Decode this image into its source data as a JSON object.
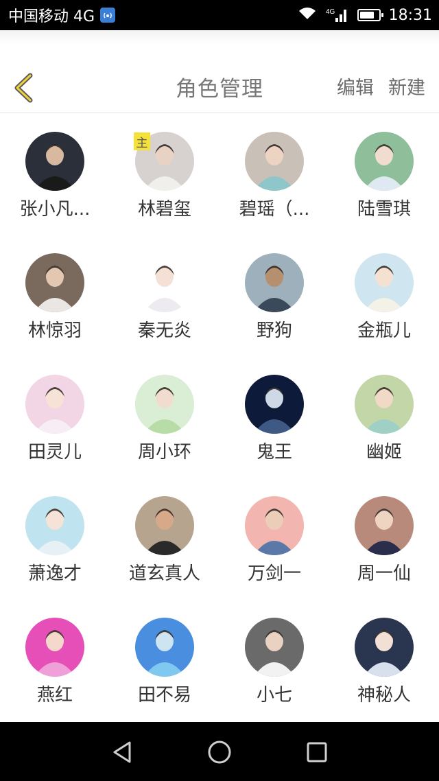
{
  "status_bar": {
    "carrier": "中国移动 4G",
    "signal_tag": "4G",
    "time": "18:31",
    "battery_level": 0.8
  },
  "header": {
    "title": "角色管理",
    "edit_label": "编辑",
    "new_label": "新建"
  },
  "owner_badge": "主",
  "characters": [
    {
      "name": "张小凡...",
      "bg": "#2a2f3a",
      "fg": "#1a1a1a",
      "skin": "#d8b8a0"
    },
    {
      "name": "林碧玺",
      "bg": "#d7d2cf",
      "fg": "#f1efec",
      "skin": "#e8d2c4"
    },
    {
      "name": "碧瑶（...",
      "bg": "#c9c0b8",
      "fg": "#8fc6c9",
      "skin": "#ecd3c2"
    },
    {
      "name": "陆雪琪",
      "bg": "#8fbf9a",
      "fg": "#dfe9f2",
      "skin": "#f0ddd0"
    },
    {
      "name": "林惊羽",
      "bg": "#7a6a5e",
      "fg": "#e9e6e3",
      "skin": "#e4c7b1"
    },
    {
      "name": "秦无炎",
      "bg": "#ffffff",
      "fg": "#eeeaf2",
      "skin": "#f4e0d4"
    },
    {
      "name": "野狗",
      "bg": "#9fb0bd",
      "fg": "#3a4a5a",
      "skin": "#b58f6e"
    },
    {
      "name": "金瓶儿",
      "bg": "#cfe6f0",
      "fg": "#f4f1e6",
      "skin": "#f5e1d2"
    },
    {
      "name": "田灵儿",
      "bg": "#f3d6e6",
      "fg": "#f7eef5",
      "skin": "#f6e2d6"
    },
    {
      "name": "周小环",
      "bg": "#d9eed5",
      "fg": "#b8dca8",
      "skin": "#f1ddd0"
    },
    {
      "name": "鬼王",
      "bg": "#0e1a3a",
      "fg": "#3e5a84",
      "skin": "#cdd9e6"
    },
    {
      "name": "幽姬",
      "bg": "#c2d6a8",
      "fg": "#9fd0c6",
      "skin": "#f1d9c8"
    },
    {
      "name": "萧逸才",
      "bg": "#bfe3ef",
      "fg": "#e7f0f5",
      "skin": "#f5e3d8"
    },
    {
      "name": "道玄真人",
      "bg": "#b7a48e",
      "fg": "#2a2a2a",
      "skin": "#d7a988"
    },
    {
      "name": "万剑一",
      "bg": "#f2b5b0",
      "fg": "#5a78a8",
      "skin": "#eccdb8"
    },
    {
      "name": "周一仙",
      "bg": "#b88a7c",
      "fg": "#2a2e4a",
      "skin": "#efd4c2"
    },
    {
      "name": "燕红",
      "bg": "#e64fb8",
      "fg": "#f0a0d8",
      "skin": "#f4d8cc"
    },
    {
      "name": "田不易",
      "bg": "#4a8ee0",
      "fg": "#7fc8f0",
      "skin": "#cfe4f2"
    },
    {
      "name": "小七",
      "bg": "#6a6a6a",
      "fg": "#f2f2f2",
      "skin": "#ead2c2"
    },
    {
      "name": "神秘人",
      "bg": "#2a3550",
      "fg": "#d8e0ee",
      "skin": "#f2e0d6"
    }
  ],
  "nav": {
    "back_icon": "triangle-back-icon",
    "home_icon": "circle-home-icon",
    "recent_icon": "square-recent-icon"
  }
}
